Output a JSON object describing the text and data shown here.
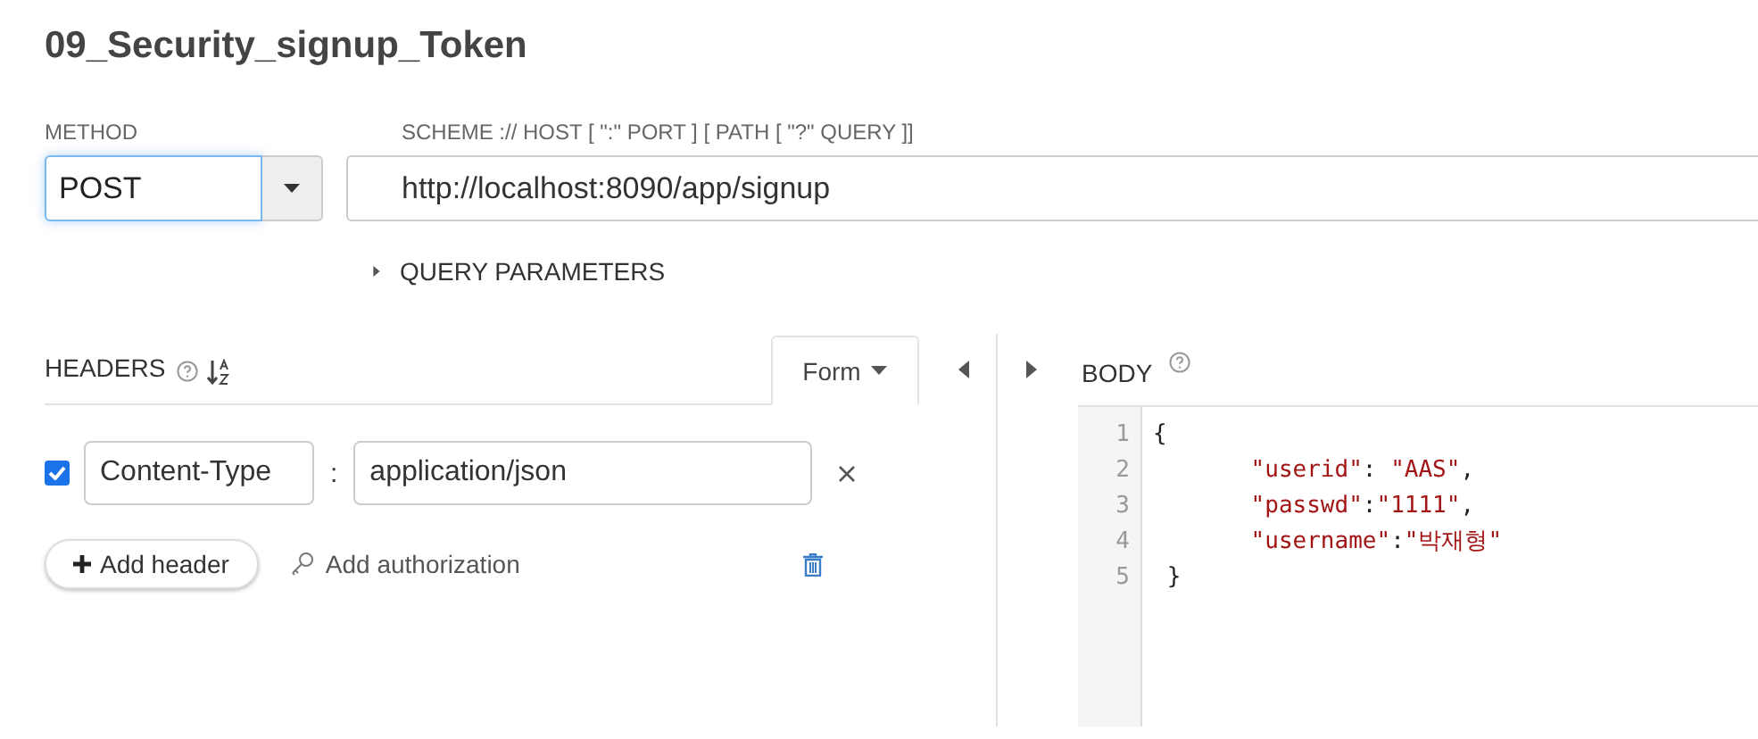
{
  "title": "09_Security_signup_Token",
  "method": {
    "label": "METHOD",
    "value": "POST"
  },
  "url": {
    "label": "SCHEME :// HOST [ \":\" PORT ] [ PATH [ \"?\" QUERY ]]",
    "value": "http://localhost:8090/app/signup"
  },
  "query_parameters": {
    "label": "QUERY PARAMETERS",
    "expanded": false
  },
  "headers": {
    "label": "HEADERS",
    "mode": "Form",
    "rows": [
      {
        "checked": true,
        "name": "Content-Type",
        "separator": ":",
        "value": "application/json"
      }
    ],
    "add_header": "Add header",
    "add_authorization": "Add authorization"
  },
  "body": {
    "label": "BODY",
    "lines": [
      {
        "number": "1",
        "tokens": [
          {
            "kind": "punct",
            "text": "{"
          }
        ]
      },
      {
        "number": "2",
        "tokens": [
          {
            "kind": "string",
            "text": "\t\"userid\""
          },
          {
            "kind": "punct",
            "text": ": "
          },
          {
            "kind": "string",
            "text": "\"AAS\""
          },
          {
            "kind": "punct",
            "text": ","
          }
        ]
      },
      {
        "number": "3",
        "tokens": [
          {
            "kind": "string",
            "text": "\t\"passwd\""
          },
          {
            "kind": "punct",
            "text": ":"
          },
          {
            "kind": "string",
            "text": "\"1111\""
          },
          {
            "kind": "punct",
            "text": ","
          }
        ]
      },
      {
        "number": "4",
        "tokens": [
          {
            "kind": "string",
            "text": "\t\"username\""
          },
          {
            "kind": "punct",
            "text": ":"
          },
          {
            "kind": "string",
            "text": "\"박재형\""
          }
        ]
      },
      {
        "number": "5",
        "tokens": [
          {
            "kind": "punct",
            "text": " }"
          }
        ]
      }
    ]
  }
}
